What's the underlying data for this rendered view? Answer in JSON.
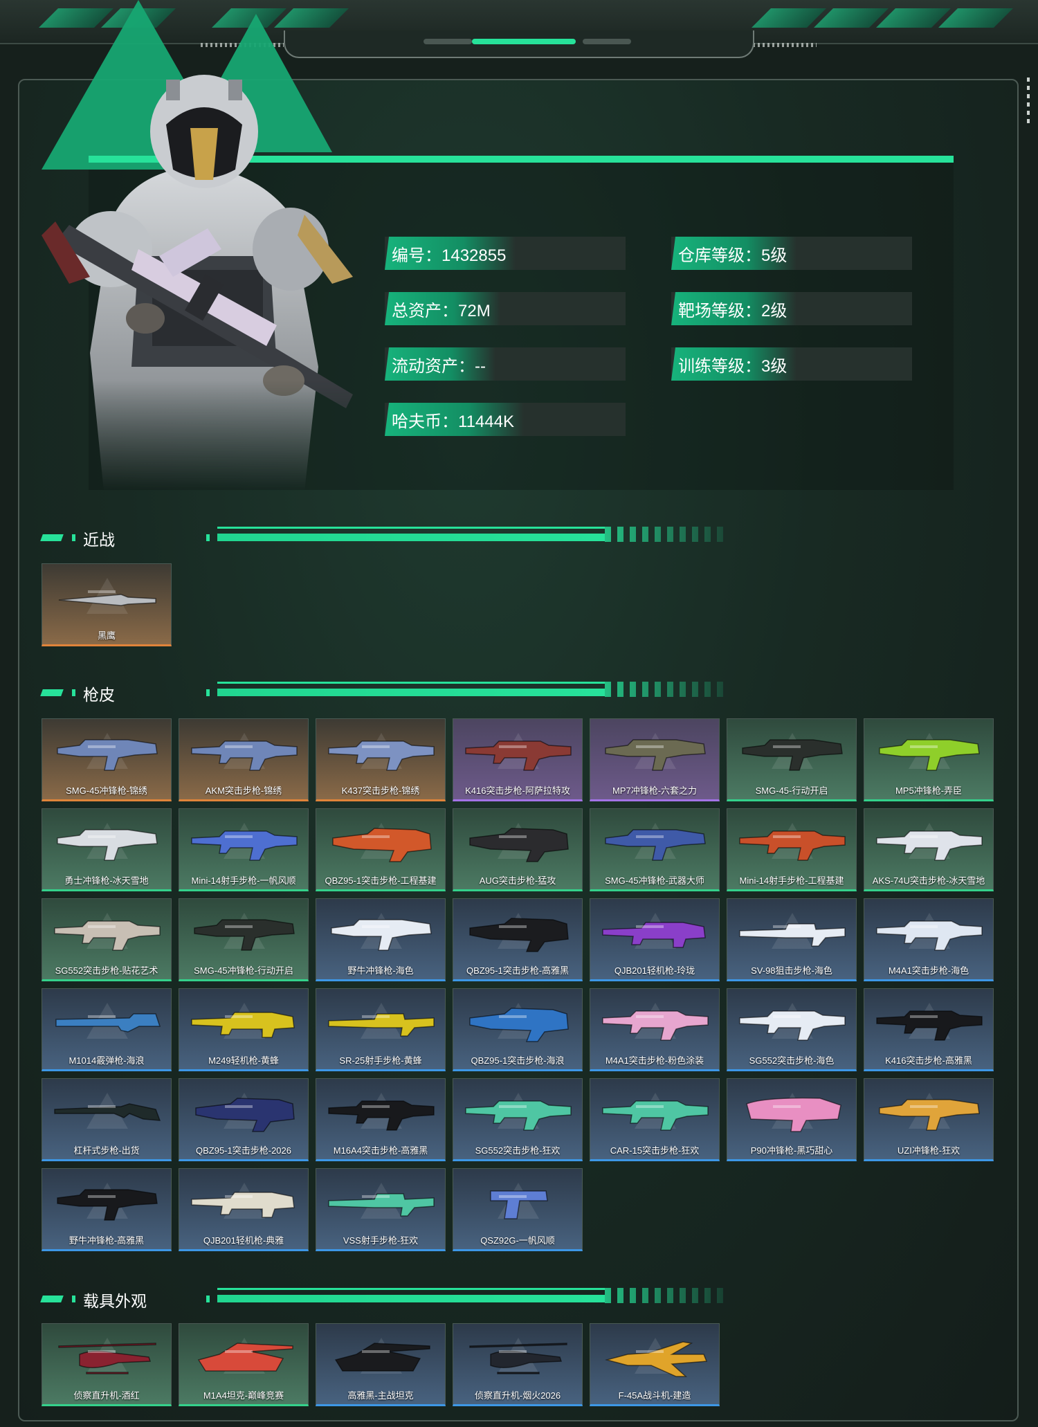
{
  "colors": {
    "accent": "#27e29a",
    "orange": "#e0843a",
    "purple": "#a373e6",
    "green": "#34d18b",
    "blue": "#3d97e6"
  },
  "profile": {
    "stats": [
      {
        "label": "编号：1432855"
      },
      {
        "label": "仓库等级：5级"
      },
      {
        "label": "总资产：72M"
      },
      {
        "label": "靶场等级：2级"
      },
      {
        "label": "流动资产：--"
      },
      {
        "label": "训练等级：3级"
      },
      {
        "label": "哈夫币：11444K"
      }
    ]
  },
  "sections": {
    "melee": {
      "title": "近战",
      "items": [
        {
          "name": "黑鹰",
          "rarity": "orange",
          "icon": "knife-icon"
        }
      ]
    },
    "gun_skins": {
      "title": "枪皮",
      "items": [
        {
          "name": "SMG-45冲锋枪-锦绣",
          "rarity": "orange",
          "icon": "smg-icon",
          "tint": "#6f86b8"
        },
        {
          "name": "AKM突击步枪-锦绣",
          "rarity": "orange",
          "icon": "rifle-icon",
          "tint": "#6f86b8"
        },
        {
          "name": "K437突击步枪-锦绣",
          "rarity": "orange",
          "icon": "rifle-icon",
          "tint": "#7d92c2"
        },
        {
          "name": "K416突击步枪-阿萨拉特攻",
          "rarity": "purple",
          "icon": "rifle-icon",
          "tint": "#8a3a34"
        },
        {
          "name": "MP7冲锋枪-六套之力",
          "rarity": "purple",
          "icon": "smg-icon",
          "tint": "#6b6a52"
        },
        {
          "name": "SMG-45-行动开启",
          "rarity": "green",
          "icon": "smg-icon",
          "tint": "#2a2f2c"
        },
        {
          "name": "MP5冲锋枪-弄臣",
          "rarity": "green",
          "icon": "smg-icon",
          "tint": "#8fcf2a"
        },
        {
          "name": "勇士冲锋枪-冰天雪地",
          "rarity": "green",
          "icon": "smg-icon",
          "tint": "#d9dde2"
        },
        {
          "name": "Mini-14射手步枪-一帆风顺",
          "rarity": "green",
          "icon": "rifle-icon",
          "tint": "#4e6fd1"
        },
        {
          "name": "QBZ95-1突击步枪-工程基建",
          "rarity": "green",
          "icon": "bullpup-icon",
          "tint": "#d2582a"
        },
        {
          "name": "AUG突击步枪-猛攻",
          "rarity": "green",
          "icon": "bullpup-icon",
          "tint": "#2b2b2e"
        },
        {
          "name": "SMG-45冲锋枪-武器大师",
          "rarity": "green",
          "icon": "smg-icon",
          "tint": "#3f5aa8"
        },
        {
          "name": "Mini-14射手步枪-工程基建",
          "rarity": "green",
          "icon": "rifle-icon",
          "tint": "#c9502a"
        },
        {
          "name": "AKS-74U突击步枪-冰天雪地",
          "rarity": "green",
          "icon": "rifle-icon",
          "tint": "#dfe3ea"
        },
        {
          "name": "SG552突击步枪-贴花艺术",
          "rarity": "green",
          "icon": "rifle-icon",
          "tint": "#c8bfb4"
        },
        {
          "name": "SMG-45冲锋枪-行动开启",
          "rarity": "green",
          "icon": "smg-icon",
          "tint": "#2a2f2c"
        },
        {
          "name": "野牛冲锋枪-海色",
          "rarity": "blue",
          "icon": "smg-icon",
          "tint": "#e6ecf4"
        },
        {
          "name": "QBZ95-1突击步枪-高雅黑",
          "rarity": "blue",
          "icon": "bullpup-icon",
          "tint": "#1b1c1f"
        },
        {
          "name": "QJB201轻机枪-玲珑",
          "rarity": "blue",
          "icon": "lmg-icon",
          "tint": "#8a3fc9"
        },
        {
          "name": "SV-98狙击步枪-海色",
          "rarity": "blue",
          "icon": "sniper-icon",
          "tint": "#e6ecf4"
        },
        {
          "name": "M4A1突击步枪-海色",
          "rarity": "blue",
          "icon": "rifle-icon",
          "tint": "#dfe7f2"
        },
        {
          "name": "M1014霰弹枪-海浪",
          "rarity": "blue",
          "icon": "shotgun-icon",
          "tint": "#3b7fc1"
        },
        {
          "name": "M249轻机枪-黄蜂",
          "rarity": "blue",
          "icon": "lmg-icon",
          "tint": "#d8c21e"
        },
        {
          "name": "SR-25射手步枪-黄蜂",
          "rarity": "blue",
          "icon": "sniper-icon",
          "tint": "#d8c21e"
        },
        {
          "name": "QBZ95-1突击步枪-海浪",
          "rarity": "blue",
          "icon": "bullpup-icon",
          "tint": "#2f74c4"
        },
        {
          "name": "M4A1突击步枪-粉色涂装",
          "rarity": "blue",
          "icon": "rifle-icon",
          "tint": "#e7a6cf"
        },
        {
          "name": "SG552突击步枪-海色",
          "rarity": "blue",
          "icon": "rifle-icon",
          "tint": "#e6ecf4"
        },
        {
          "name": "K416突击步枪-高雅黑",
          "rarity": "blue",
          "icon": "rifle-icon",
          "tint": "#18191c"
        },
        {
          "name": "杠杆式步枪-出货",
          "rarity": "blue",
          "icon": "lever-rifle-icon",
          "tint": "#1f2a2a"
        },
        {
          "name": "QBZ95-1突击步枪-2026",
          "rarity": "blue",
          "icon": "bullpup-icon",
          "tint": "#2a3470"
        },
        {
          "name": "M16A4突击步枪-高雅黑",
          "rarity": "blue",
          "icon": "rifle-icon",
          "tint": "#18191c"
        },
        {
          "name": "SG552突击步枪-狂欢",
          "rarity": "blue",
          "icon": "rifle-icon",
          "tint": "#4fc6a3"
        },
        {
          "name": "CAR-15突击步枪-狂欢",
          "rarity": "blue",
          "icon": "rifle-icon",
          "tint": "#4fc6a3"
        },
        {
          "name": "P90冲锋枪-黑巧甜心",
          "rarity": "blue",
          "icon": "p90-icon",
          "tint": "#e88fc2"
        },
        {
          "name": "UZI冲锋枪-狂欢",
          "rarity": "blue",
          "icon": "smg-icon",
          "tint": "#e0a43a"
        },
        {
          "name": "野牛冲锋枪-高雅黑",
          "rarity": "blue",
          "icon": "smg-icon",
          "tint": "#18191c"
        },
        {
          "name": "QJB201轻机枪-典雅",
          "rarity": "blue",
          "icon": "lmg-icon",
          "tint": "#e0dccd"
        },
        {
          "name": "VSS射手步枪-狂欢",
          "rarity": "blue",
          "icon": "sniper-icon",
          "tint": "#4fc6a3"
        },
        {
          "name": "QSZ92G-一帆风顺",
          "rarity": "blue",
          "icon": "pistol-icon",
          "tint": "#5e7ed4"
        }
      ]
    },
    "vehicles": {
      "title": "载具外观",
      "items": [
        {
          "name": "侦察直升机-酒红",
          "rarity": "green",
          "icon": "helicopter-icon",
          "tint": "#8a2230"
        },
        {
          "name": "M1A4坦克-巅峰竞赛",
          "rarity": "green",
          "icon": "tank-icon",
          "tint": "#d84a3a"
        },
        {
          "name": "高雅黑-主战坦克",
          "rarity": "blue",
          "icon": "tank-icon",
          "tint": "#1a1b1e"
        },
        {
          "name": "侦察直升机-烟火2026",
          "rarity": "blue",
          "icon": "helicopter-icon",
          "tint": "#22262e"
        },
        {
          "name": "F-45A战斗机-建造",
          "rarity": "blue",
          "icon": "jet-icon",
          "tint": "#e0a42a"
        }
      ]
    }
  }
}
